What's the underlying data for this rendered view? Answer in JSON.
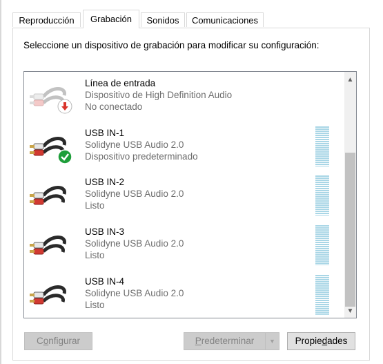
{
  "tabs": [
    {
      "label": "Reproducción"
    },
    {
      "label": "Grabación"
    },
    {
      "label": "Sonidos"
    },
    {
      "label": "Comunicaciones"
    }
  ],
  "active_tab": "Grabación",
  "description": "Seleccione un dispositivo de grabación para modificar su configuración:",
  "devices": [
    {
      "name": "Línea de entrada",
      "driver": "Dispositivo de High Definition Audio",
      "status": "No conectado",
      "badge_icon": "red-down-arrow-icon",
      "connected": false
    },
    {
      "name": "USB IN-1",
      "driver": "Solidyne USB Audio 2.0",
      "status": "Dispositivo predeterminado",
      "badge_icon": "green-check-icon",
      "connected": true
    },
    {
      "name": "USB IN-2",
      "driver": "Solidyne USB Audio 2.0",
      "status": "Listo",
      "connected": true
    },
    {
      "name": "USB IN-3",
      "driver": "Solidyne USB Audio 2.0",
      "status": "Listo",
      "connected": true
    },
    {
      "name": "USB IN-4",
      "driver": "Solidyne USB Audio 2.0",
      "status": "Listo",
      "connected": true
    }
  ],
  "buttons": {
    "configurar": {
      "pre": "C",
      "u": "o",
      "post": "nfigurar"
    },
    "predeterminar": {
      "pre": "",
      "u": "P",
      "post": "redeterminar"
    },
    "propiedades": {
      "pre": "Propie",
      "u": "d",
      "post": "ades"
    }
  },
  "colors": {
    "meter": "#a9d6e6",
    "accent_ok": "#1e9e3a",
    "accent_error": "#d9342b"
  }
}
